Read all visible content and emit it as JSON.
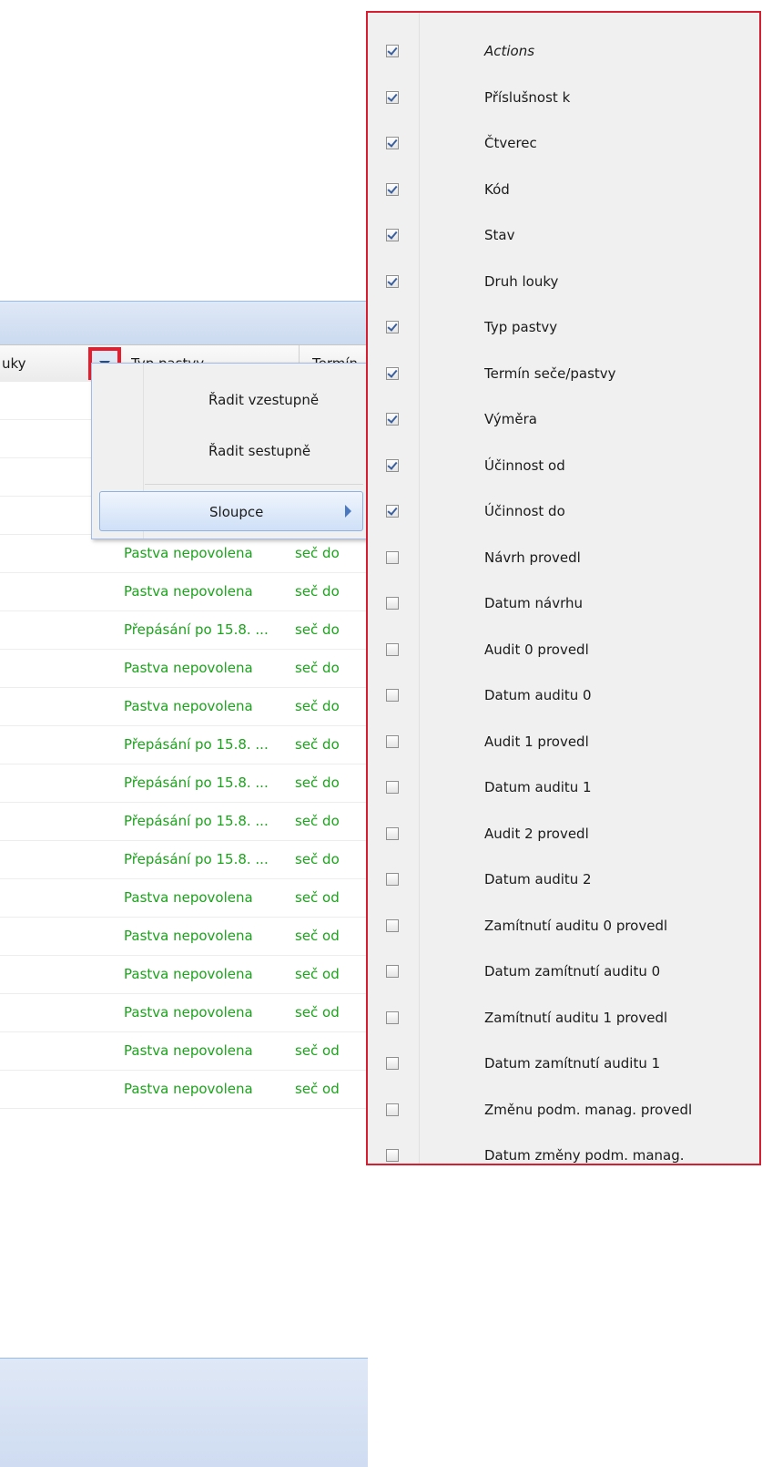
{
  "grid": {
    "header": {
      "col_prev_partial": "uky",
      "col_typ_pastvy": "Typ pastvy",
      "col_next_partial": "Termín"
    },
    "rows": [
      {
        "typ": "",
        "termin": ""
      },
      {
        "typ": "",
        "termin": ""
      },
      {
        "typ": "",
        "termin": ""
      },
      {
        "typ": "",
        "termin": ""
      },
      {
        "typ": "Pastva nepovolena",
        "termin": "seč do"
      },
      {
        "typ": "Pastva nepovolena",
        "termin": "seč do"
      },
      {
        "typ": "Přepásání po 15.8. ...",
        "termin": "seč do"
      },
      {
        "typ": "Pastva nepovolena",
        "termin": "seč do"
      },
      {
        "typ": "Pastva nepovolena",
        "termin": "seč do"
      },
      {
        "typ": "Přepásání po 15.8. ...",
        "termin": "seč do"
      },
      {
        "typ": "Přepásání po 15.8. ...",
        "termin": "seč do"
      },
      {
        "typ": "Přepásání po 15.8. ...",
        "termin": "seč do"
      },
      {
        "typ": "Přepásání po 15.8. ...",
        "termin": "seč do"
      },
      {
        "typ": "Pastva nepovolena",
        "termin": "seč od"
      },
      {
        "typ": "Pastva nepovolena",
        "termin": "seč od"
      },
      {
        "typ": "Pastva nepovolena",
        "termin": "seč od"
      },
      {
        "typ": "Pastva nepovolena",
        "termin": "seč od"
      },
      {
        "typ": "Pastva nepovolena",
        "termin": "seč od"
      },
      {
        "typ": "Pastva nepovolena",
        "termin": "seč od"
      }
    ]
  },
  "context_menu": {
    "sort_asc": "Řadit vzestupně",
    "sort_desc": "Řadit sestupně",
    "columns": "Sloupce"
  },
  "columns_menu": [
    {
      "label": "Actions",
      "checked": true
    },
    {
      "label": "Příslušnost k",
      "checked": true
    },
    {
      "label": "Čtverec",
      "checked": true
    },
    {
      "label": "Kód",
      "checked": true
    },
    {
      "label": "Stav",
      "checked": true
    },
    {
      "label": "Druh louky",
      "checked": true
    },
    {
      "label": "Typ pastvy",
      "checked": true
    },
    {
      "label": "Termín seče/pastvy",
      "checked": true
    },
    {
      "label": "Výměra",
      "checked": true
    },
    {
      "label": "Účinnost od",
      "checked": true
    },
    {
      "label": "Účinnost do",
      "checked": true
    },
    {
      "label": "Návrh provedl",
      "checked": false
    },
    {
      "label": "Datum návrhu",
      "checked": false
    },
    {
      "label": "Audit 0 provedl",
      "checked": false
    },
    {
      "label": "Datum auditu 0",
      "checked": false
    },
    {
      "label": "Audit 1 provedl",
      "checked": false
    },
    {
      "label": "Datum auditu 1",
      "checked": false
    },
    {
      "label": "Audit 2 provedl",
      "checked": false
    },
    {
      "label": "Datum auditu 2",
      "checked": false
    },
    {
      "label": "Zamítnutí auditu 0 provedl",
      "checked": false
    },
    {
      "label": "Datum zamítnutí auditu 0",
      "checked": false
    },
    {
      "label": "Zamítnutí auditu 1 provedl",
      "checked": false
    },
    {
      "label": "Datum zamítnutí auditu 1",
      "checked": false
    },
    {
      "label": "Změnu podm. manag. provedl",
      "checked": false
    },
    {
      "label": "Datum změny podm. manag.",
      "checked": false
    }
  ],
  "colors": {
    "highlight_border": "#e81c2c",
    "green_text": "#1ca31c",
    "header_blue": "#cbdaf0"
  }
}
